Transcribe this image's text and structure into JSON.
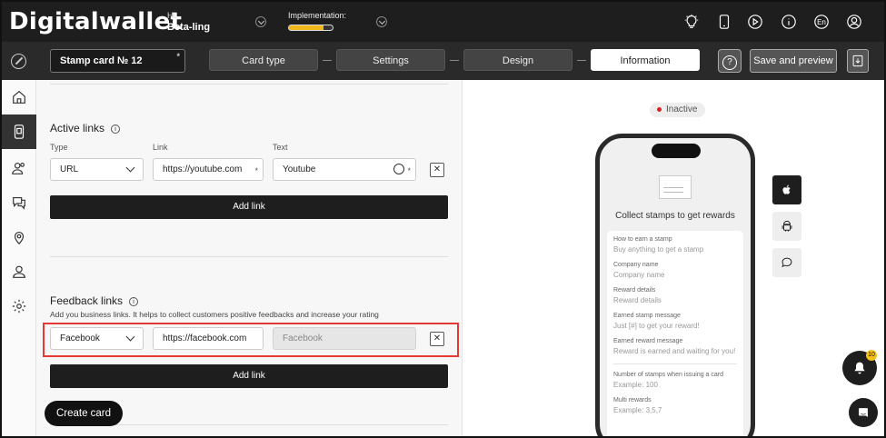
{
  "header": {
    "logo": "Digitalwallet",
    "greeting": "Hi,",
    "user_name": "Beta-ling",
    "implementation_label": "Implementation:",
    "implementation_progress": 0.8,
    "language": "En",
    "icons": [
      "lightbulb-icon",
      "phone-icon",
      "play-icon",
      "info-icon",
      "language-icon",
      "avatar-icon"
    ]
  },
  "stepbar": {
    "card_name": "Stamp card № 12",
    "required_mark": "*",
    "steps": [
      "Card type",
      "Settings",
      "Design",
      "Information"
    ],
    "active_step": "Information",
    "help_label": "?",
    "save_preview_label": "Save and preview"
  },
  "sidebar": {
    "items": [
      "home-icon",
      "cards-icon",
      "users-icon",
      "chat-icon",
      "location-icon",
      "profile-icon",
      "settings-icon"
    ],
    "active": "cards-icon"
  },
  "active_links": {
    "title": "Active links",
    "type_label": "Type",
    "link_label": "Link",
    "text_label": "Text",
    "type_value": "URL",
    "link_value": "https://youtube.com",
    "text_value": "Youtube",
    "required_mark": "*",
    "add_label": "Add link"
  },
  "feedback_links": {
    "title": "Feedback links",
    "help": "Add you business links. It helps to collect customers positive feedbacks and increase your rating",
    "type_value": "Facebook",
    "link_value": "https://facebook.com",
    "text_placeholder": "Facebook",
    "add_label": "Add link"
  },
  "create_card_label": "Create card",
  "preview": {
    "status": "Inactive",
    "status_color": "#e02020",
    "title": "Collect stamps to get rewards",
    "fields": [
      {
        "key": "How to earn a stamp",
        "value": "Buy anything to get a stamp"
      },
      {
        "key": "Company name",
        "value": "Company name"
      },
      {
        "key": "Reward details",
        "value": "Reward details"
      },
      {
        "key": "Earned stamp message",
        "value": "Just [#] to get your reward!"
      },
      {
        "key": "Earned reward message",
        "value": "Reward is earned and waiting for you!"
      },
      {
        "key": "Number of stamps when issuing a card",
        "value": "Example: 100"
      },
      {
        "key": "Multi rewards",
        "value": "Example: 3,5,7"
      }
    ],
    "platforms": [
      "apple-icon",
      "android-icon",
      "chat-bubble-icon"
    ]
  },
  "notifications": {
    "count": "10"
  }
}
